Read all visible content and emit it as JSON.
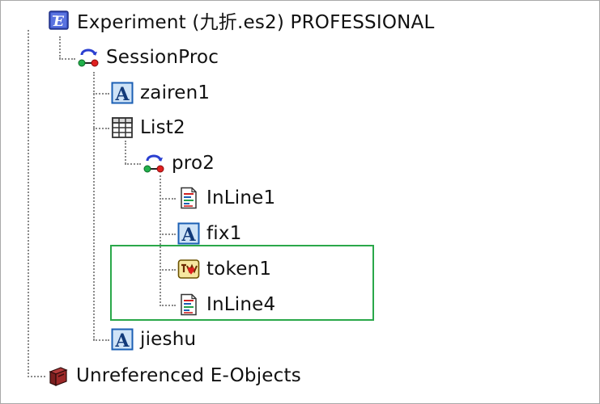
{
  "tree": {
    "root": {
      "label": "Experiment (九折.es2) PROFESSIONAL",
      "icon": "experiment-icon"
    },
    "session_proc": {
      "label": "SessionProc",
      "icon": "procedure-icon"
    },
    "zairen1": {
      "label": "zairen1",
      "icon": "text-display-icon"
    },
    "list2": {
      "label": "List2",
      "icon": "list-grid-icon"
    },
    "pro2": {
      "label": "pro2",
      "icon": "procedure-icon"
    },
    "inline1": {
      "label": "InLine1",
      "icon": "inline-script-icon"
    },
    "fix1": {
      "label": "fix1",
      "icon": "text-display-icon"
    },
    "token1": {
      "label": "token1",
      "icon": "token-icon"
    },
    "inline4": {
      "label": "InLine4",
      "icon": "inline-script-icon"
    },
    "jieshu": {
      "label": "jieshu",
      "icon": "text-display-icon"
    },
    "unreferenced": {
      "label": "Unreferenced E-Objects",
      "icon": "unreferenced-objects-icon"
    }
  },
  "colors": {
    "highlight_border": "#2aa84a",
    "connector": "#8a8a8a",
    "text_icon_blue": "#1b5fb4"
  }
}
